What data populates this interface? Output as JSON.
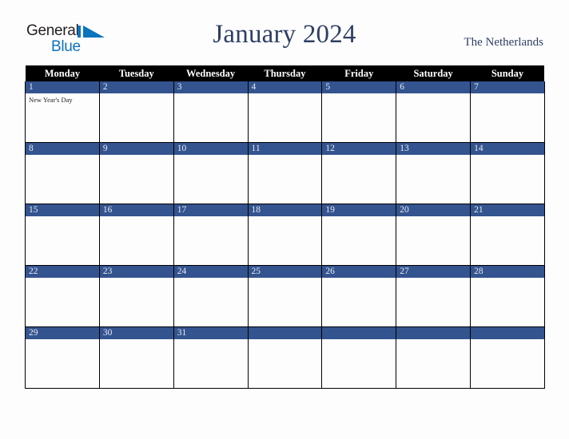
{
  "header": {
    "logo": {
      "word_one": "General",
      "word_two": "Blue",
      "mark_name": "general-blue-triangle-logo"
    },
    "title": "January 2024",
    "region": "The Netherlands"
  },
  "calendar": {
    "weekday_headers": [
      "Monday",
      "Tuesday",
      "Wednesday",
      "Thursday",
      "Friday",
      "Saturday",
      "Sunday"
    ],
    "colors": {
      "day_bar": "#34548f",
      "header_bar": "#000000",
      "title_text": "#2e3f63",
      "cell_background": "#fdfdfe",
      "grid_line": "#000000",
      "logo_blue": "#0c73bd"
    },
    "weeks": [
      [
        {
          "date": "1",
          "events": [
            "New Year's Day"
          ]
        },
        {
          "date": "2",
          "events": []
        },
        {
          "date": "3",
          "events": []
        },
        {
          "date": "4",
          "events": []
        },
        {
          "date": "5",
          "events": []
        },
        {
          "date": "6",
          "events": []
        },
        {
          "date": "7",
          "events": []
        }
      ],
      [
        {
          "date": "8",
          "events": []
        },
        {
          "date": "9",
          "events": []
        },
        {
          "date": "10",
          "events": []
        },
        {
          "date": "11",
          "events": []
        },
        {
          "date": "12",
          "events": []
        },
        {
          "date": "13",
          "events": []
        },
        {
          "date": "14",
          "events": []
        }
      ],
      [
        {
          "date": "15",
          "events": []
        },
        {
          "date": "16",
          "events": []
        },
        {
          "date": "17",
          "events": []
        },
        {
          "date": "18",
          "events": []
        },
        {
          "date": "19",
          "events": []
        },
        {
          "date": "20",
          "events": []
        },
        {
          "date": "21",
          "events": []
        }
      ],
      [
        {
          "date": "22",
          "events": []
        },
        {
          "date": "23",
          "events": []
        },
        {
          "date": "24",
          "events": []
        },
        {
          "date": "25",
          "events": []
        },
        {
          "date": "26",
          "events": []
        },
        {
          "date": "27",
          "events": []
        },
        {
          "date": "28",
          "events": []
        }
      ],
      [
        {
          "date": "29",
          "events": []
        },
        {
          "date": "30",
          "events": []
        },
        {
          "date": "31",
          "events": []
        },
        {
          "date": "",
          "events": []
        },
        {
          "date": "",
          "events": []
        },
        {
          "date": "",
          "events": []
        },
        {
          "date": "",
          "events": []
        }
      ]
    ]
  }
}
